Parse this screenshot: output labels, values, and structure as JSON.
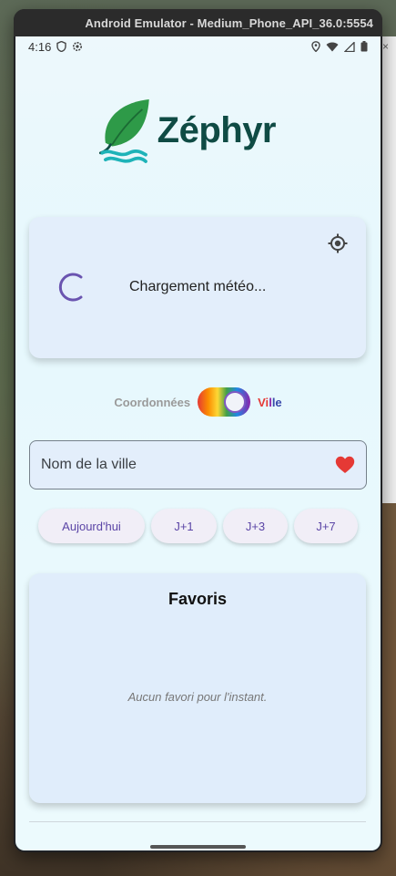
{
  "window": {
    "title": "Android Emulator - Medium_Phone_API_36.0:5554"
  },
  "status_bar": {
    "time": "4:16"
  },
  "app": {
    "name": "Zéphyr"
  },
  "weather": {
    "loading_text": "Chargement météo..."
  },
  "mode": {
    "left_label": "Coordonnées",
    "right_label_parts": [
      "Vi",
      "l",
      "le"
    ]
  },
  "search": {
    "placeholder": "Nom de la ville"
  },
  "days": [
    {
      "label": "Aujourd'hui"
    },
    {
      "label": "J+1"
    },
    {
      "label": "J+3"
    },
    {
      "label": "J+7"
    }
  ],
  "favorites": {
    "title": "Favoris",
    "empty_text": "Aucun favori pour l'instant."
  },
  "colors": {
    "brand_dark": "#0f4b44",
    "leaf_green": "#2e9a48",
    "wave_teal": "#1eb3b8",
    "accent_purple": "#5b45a6",
    "heart_red": "#e53935"
  }
}
